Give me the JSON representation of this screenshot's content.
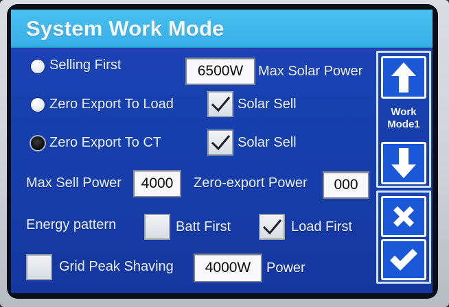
{
  "title": "System Work Mode",
  "modes": [
    {
      "label": "Selling First",
      "selected": false
    },
    {
      "label": "Zero Export To Load",
      "selected": false
    },
    {
      "label": "Zero Export To CT",
      "selected": true
    }
  ],
  "max_solar_power": {
    "value": "6500W",
    "label": "Max Solar Power"
  },
  "solar_sell_1": {
    "label": "Solar Sell",
    "checked": true
  },
  "solar_sell_2": {
    "label": "Solar Sell",
    "checked": true
  },
  "max_sell_power": {
    "label": "Max Sell Power",
    "value": "4000"
  },
  "zero_export_power": {
    "label": "Zero-export Power",
    "value": "000"
  },
  "energy_pattern": {
    "label": "Energy pattern",
    "options": [
      {
        "label": "Batt First",
        "checked": false
      },
      {
        "label": "Load First",
        "checked": true
      }
    ]
  },
  "grid_peak_shaving": {
    "label": "Grid Peak Shaving",
    "checked": false,
    "value": "4000W",
    "unit_label": "Power"
  },
  "sidebar": {
    "work_mode_line1": "Work",
    "work_mode_line2": "Mode1",
    "up_icon": "arrow-up-icon",
    "down_icon": "arrow-down-icon",
    "cancel_icon": "close-icon",
    "confirm_icon": "check-icon"
  },
  "colors": {
    "panel": "#1640ad",
    "title_bar": "#37aee6",
    "button": "#1a58d8",
    "text": "#e9efff"
  }
}
